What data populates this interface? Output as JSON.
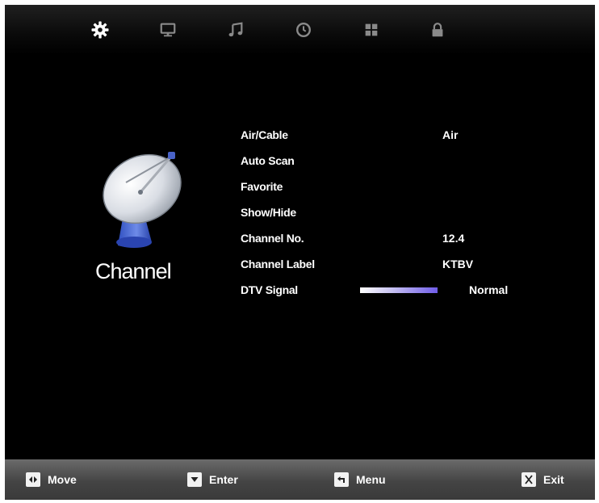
{
  "top_tabs": [
    {
      "icon": "gear-icon",
      "active": true
    },
    {
      "icon": "monitor-icon",
      "active": false
    },
    {
      "icon": "music-note-icon",
      "active": false
    },
    {
      "icon": "clock-icon",
      "active": false
    },
    {
      "icon": "grid-icon",
      "active": false
    },
    {
      "icon": "lock-icon",
      "active": false
    }
  ],
  "section": {
    "title": "Channel",
    "icon": "satellite-dish-icon"
  },
  "menu": [
    {
      "label": "Air/Cable",
      "value": "Air"
    },
    {
      "label": "Auto Scan",
      "value": ""
    },
    {
      "label": "Favorite",
      "value": ""
    },
    {
      "label": "Show/Hide",
      "value": ""
    },
    {
      "label": "Channel No.",
      "value": "12.4"
    },
    {
      "label": "Channel Label",
      "value": "KTBV"
    },
    {
      "label": "DTV Signal",
      "value": "Normal"
    }
  ],
  "signal_level": 1.0,
  "colors": {
    "background": "#000000",
    "text": "#ffffff",
    "signal_accent": "#6f5ce8",
    "footer": "#4a4a4a"
  },
  "footer": {
    "move": {
      "label": "Move",
      "icon": "move-key-icon"
    },
    "enter": {
      "label": "Enter",
      "icon": "enter-key-icon"
    },
    "menu": {
      "label": "Menu",
      "icon": "menu-key-icon"
    },
    "exit": {
      "label": "Exit",
      "icon": "exit-key-icon"
    }
  }
}
